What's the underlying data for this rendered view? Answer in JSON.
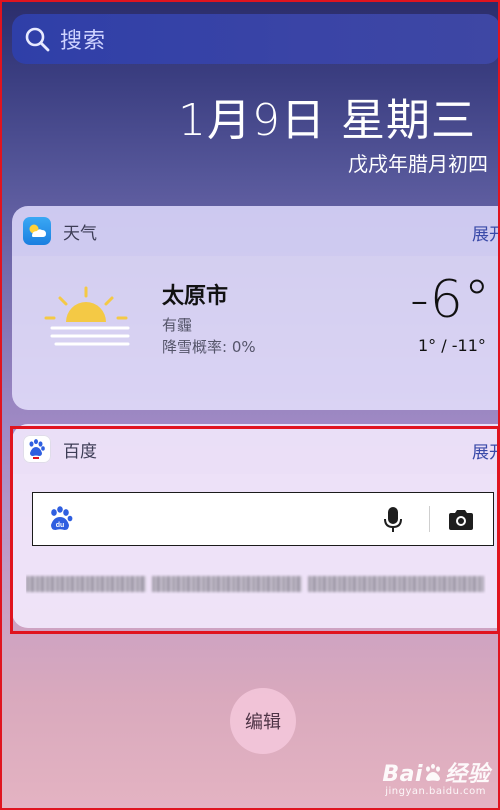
{
  "search": {
    "placeholder": "搜索"
  },
  "date": {
    "main": "1月9日 星期三",
    "lunar": "戊戌年腊月初四"
  },
  "weather_widget": {
    "app_name": "天气",
    "expand_label": "展开",
    "city": "太原市",
    "condition": "有霾",
    "snow_probability": "降雪概率: 0%",
    "current_temp": "-6°",
    "temp_range": "1° / -11°",
    "icon": "sun-haze-icon"
  },
  "baidu_widget": {
    "app_name": "百度",
    "expand_label": "展开",
    "search_icons": [
      "baidu-paw-icon",
      "microphone-icon",
      "camera-icon"
    ]
  },
  "edit_button": {
    "label": "编辑"
  },
  "watermark": {
    "brand": "Bai",
    "brand_suffix": "经验",
    "url": "jingyan.baidu.com"
  },
  "colors": {
    "highlight": "#e0141f",
    "search_bar": "#3240a8",
    "expand_link": "#3a4aa8"
  }
}
